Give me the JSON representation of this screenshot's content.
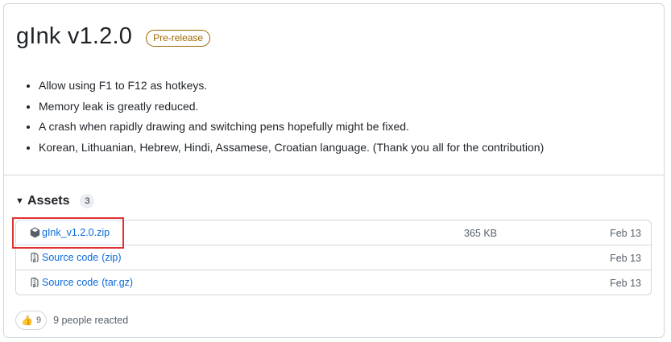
{
  "release": {
    "title": "gInk v1.2.0",
    "badge": "Pre-release",
    "notes": [
      "Allow using F1 to F12 as hotkeys.",
      "Memory leak is greatly reduced.",
      "A crash when rapidly drawing and switching pens hopefully might be fixed.",
      "Korean, Lithuanian, Hebrew, Hindi, Assamese, Croatian language. (Thank you all for the contribution)"
    ]
  },
  "assets": {
    "title": "Assets",
    "count": "3",
    "items": [
      {
        "icon": "package-icon",
        "name": "gInk_v1.2.0.zip",
        "ext": "",
        "size": "365 KB",
        "date": "Feb 13"
      },
      {
        "icon": "file-zip-icon",
        "name": "Source code",
        "ext": "(zip)",
        "size": "",
        "date": "Feb 13"
      },
      {
        "icon": "file-zip-icon",
        "name": "Source code",
        "ext": "(tar.gz)",
        "size": "",
        "date": "Feb 13"
      }
    ]
  },
  "reactions": {
    "emoji": "👍",
    "count": "9",
    "summary": "9 people reacted"
  },
  "colors": {
    "link": "#0969da",
    "prerelease": "#9a6700",
    "highlight": "#e03131"
  }
}
